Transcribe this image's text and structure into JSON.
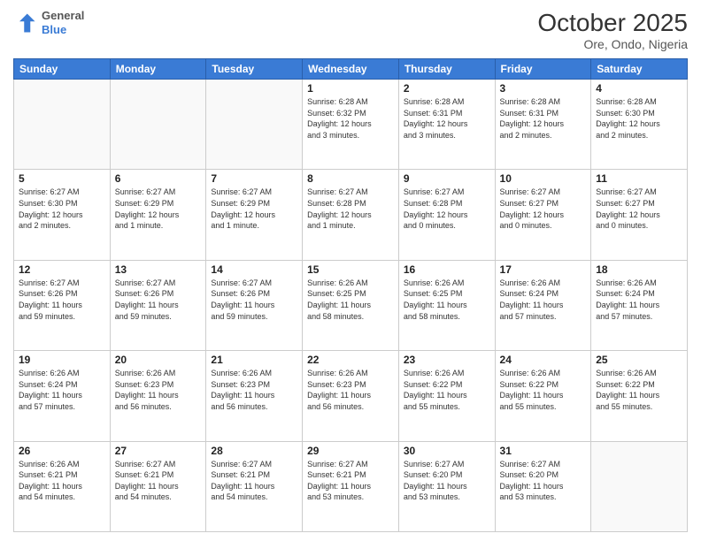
{
  "header": {
    "logo_general": "General",
    "logo_blue": "Blue",
    "month_title": "October 2025",
    "location": "Ore, Ondo, Nigeria"
  },
  "weekdays": [
    "Sunday",
    "Monday",
    "Tuesday",
    "Wednesday",
    "Thursday",
    "Friday",
    "Saturday"
  ],
  "weeks": [
    [
      {
        "day": "",
        "info": ""
      },
      {
        "day": "",
        "info": ""
      },
      {
        "day": "",
        "info": ""
      },
      {
        "day": "1",
        "info": "Sunrise: 6:28 AM\nSunset: 6:32 PM\nDaylight: 12 hours\nand 3 minutes."
      },
      {
        "day": "2",
        "info": "Sunrise: 6:28 AM\nSunset: 6:31 PM\nDaylight: 12 hours\nand 3 minutes."
      },
      {
        "day": "3",
        "info": "Sunrise: 6:28 AM\nSunset: 6:31 PM\nDaylight: 12 hours\nand 2 minutes."
      },
      {
        "day": "4",
        "info": "Sunrise: 6:28 AM\nSunset: 6:30 PM\nDaylight: 12 hours\nand 2 minutes."
      }
    ],
    [
      {
        "day": "5",
        "info": "Sunrise: 6:27 AM\nSunset: 6:30 PM\nDaylight: 12 hours\nand 2 minutes."
      },
      {
        "day": "6",
        "info": "Sunrise: 6:27 AM\nSunset: 6:29 PM\nDaylight: 12 hours\nand 1 minute."
      },
      {
        "day": "7",
        "info": "Sunrise: 6:27 AM\nSunset: 6:29 PM\nDaylight: 12 hours\nand 1 minute."
      },
      {
        "day": "8",
        "info": "Sunrise: 6:27 AM\nSunset: 6:28 PM\nDaylight: 12 hours\nand 1 minute."
      },
      {
        "day": "9",
        "info": "Sunrise: 6:27 AM\nSunset: 6:28 PM\nDaylight: 12 hours\nand 0 minutes."
      },
      {
        "day": "10",
        "info": "Sunrise: 6:27 AM\nSunset: 6:27 PM\nDaylight: 12 hours\nand 0 minutes."
      },
      {
        "day": "11",
        "info": "Sunrise: 6:27 AM\nSunset: 6:27 PM\nDaylight: 12 hours\nand 0 minutes."
      }
    ],
    [
      {
        "day": "12",
        "info": "Sunrise: 6:27 AM\nSunset: 6:26 PM\nDaylight: 11 hours\nand 59 minutes."
      },
      {
        "day": "13",
        "info": "Sunrise: 6:27 AM\nSunset: 6:26 PM\nDaylight: 11 hours\nand 59 minutes."
      },
      {
        "day": "14",
        "info": "Sunrise: 6:27 AM\nSunset: 6:26 PM\nDaylight: 11 hours\nand 59 minutes."
      },
      {
        "day": "15",
        "info": "Sunrise: 6:26 AM\nSunset: 6:25 PM\nDaylight: 11 hours\nand 58 minutes."
      },
      {
        "day": "16",
        "info": "Sunrise: 6:26 AM\nSunset: 6:25 PM\nDaylight: 11 hours\nand 58 minutes."
      },
      {
        "day": "17",
        "info": "Sunrise: 6:26 AM\nSunset: 6:24 PM\nDaylight: 11 hours\nand 57 minutes."
      },
      {
        "day": "18",
        "info": "Sunrise: 6:26 AM\nSunset: 6:24 PM\nDaylight: 11 hours\nand 57 minutes."
      }
    ],
    [
      {
        "day": "19",
        "info": "Sunrise: 6:26 AM\nSunset: 6:24 PM\nDaylight: 11 hours\nand 57 minutes."
      },
      {
        "day": "20",
        "info": "Sunrise: 6:26 AM\nSunset: 6:23 PM\nDaylight: 11 hours\nand 56 minutes."
      },
      {
        "day": "21",
        "info": "Sunrise: 6:26 AM\nSunset: 6:23 PM\nDaylight: 11 hours\nand 56 minutes."
      },
      {
        "day": "22",
        "info": "Sunrise: 6:26 AM\nSunset: 6:23 PM\nDaylight: 11 hours\nand 56 minutes."
      },
      {
        "day": "23",
        "info": "Sunrise: 6:26 AM\nSunset: 6:22 PM\nDaylight: 11 hours\nand 55 minutes."
      },
      {
        "day": "24",
        "info": "Sunrise: 6:26 AM\nSunset: 6:22 PM\nDaylight: 11 hours\nand 55 minutes."
      },
      {
        "day": "25",
        "info": "Sunrise: 6:26 AM\nSunset: 6:22 PM\nDaylight: 11 hours\nand 55 minutes."
      }
    ],
    [
      {
        "day": "26",
        "info": "Sunrise: 6:26 AM\nSunset: 6:21 PM\nDaylight: 11 hours\nand 54 minutes."
      },
      {
        "day": "27",
        "info": "Sunrise: 6:27 AM\nSunset: 6:21 PM\nDaylight: 11 hours\nand 54 minutes."
      },
      {
        "day": "28",
        "info": "Sunrise: 6:27 AM\nSunset: 6:21 PM\nDaylight: 11 hours\nand 54 minutes."
      },
      {
        "day": "29",
        "info": "Sunrise: 6:27 AM\nSunset: 6:21 PM\nDaylight: 11 hours\nand 53 minutes."
      },
      {
        "day": "30",
        "info": "Sunrise: 6:27 AM\nSunset: 6:20 PM\nDaylight: 11 hours\nand 53 minutes."
      },
      {
        "day": "31",
        "info": "Sunrise: 6:27 AM\nSunset: 6:20 PM\nDaylight: 11 hours\nand 53 minutes."
      },
      {
        "day": "",
        "info": ""
      }
    ]
  ]
}
